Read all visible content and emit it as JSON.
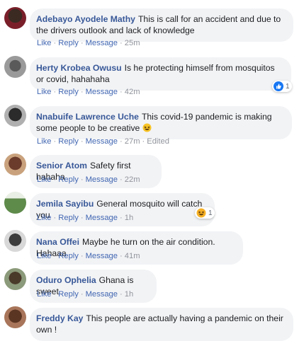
{
  "actions": {
    "like": "Like",
    "reply": "Reply",
    "message": "Message",
    "separator": "·"
  },
  "comments": [
    {
      "author": "Adebayo Ayodele Mathy",
      "text": "This is call for an accident and due to the drivers outlook and lack of knowledge",
      "time": "25m",
      "avatar": "avatar-photo"
    },
    {
      "author": "Herty Krobea Owusu",
      "text": "Is he protecting himself from mosquitos or covid, hahahaha",
      "time": "42m",
      "avatar": "avatar-photo",
      "reaction": {
        "icon": "like-icon",
        "count": "1"
      }
    },
    {
      "author": "Nnabuife Lawrence Uche",
      "text": "This covid-19 pandemic is making some people to be creative",
      "emoji": "laughing-face-icon",
      "time": "27m",
      "edited": "Edited",
      "avatar": "avatar-photo"
    },
    {
      "author": "Senior Atom",
      "text": "Safety first hahaha",
      "time": "22m",
      "avatar": "avatar-photo"
    },
    {
      "author": "Jemila Sayibu",
      "text": "General mosquito will catch you",
      "time": "1h",
      "avatar": "avatar-photo",
      "reaction": {
        "icon": "haha-icon",
        "count": "1"
      }
    },
    {
      "author": "Nana Offei",
      "text": "Maybe he turn on the air condition. Hahaaa",
      "time": "41m",
      "avatar": "avatar-photo"
    },
    {
      "author": "Oduro Ophelia",
      "text": "Ghana is sweet",
      "time": "1h",
      "avatar": "avatar-photo"
    },
    {
      "author": "Freddy Kay",
      "text": "This people are actually having a pandemic on their own !",
      "avatar": "avatar-photo"
    }
  ],
  "colors": {
    "author": "#385898",
    "action": "#4267b2",
    "bubble": "#f2f3f5",
    "meta": "#90949c",
    "like": "#1877f2",
    "haha": "#f7b125"
  }
}
